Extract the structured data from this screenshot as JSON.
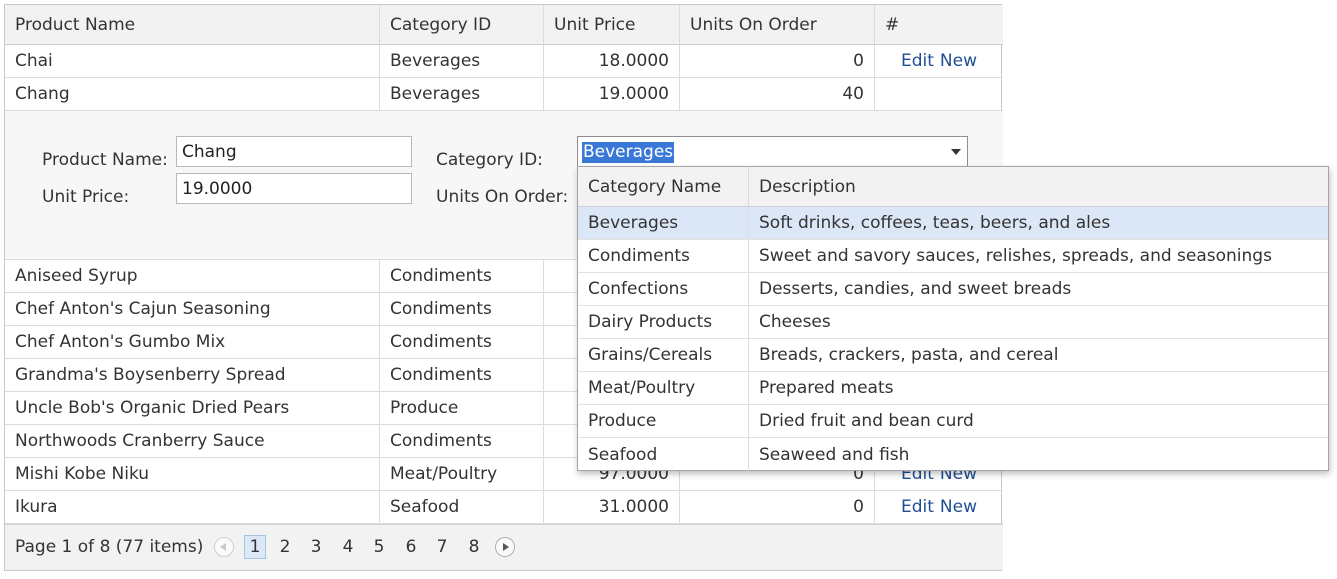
{
  "grid": {
    "headers": [
      "Product Name",
      "Category ID",
      "Unit Price",
      "Units On Order",
      "#"
    ],
    "rows_top": [
      {
        "name": "Chai",
        "category": "Beverages",
        "price": "18.0000",
        "on_order": "0",
        "edit": "Edit",
        "new": "New"
      },
      {
        "name": "Chang",
        "category": "Beverages",
        "price": "19.0000",
        "on_order": "40",
        "edit": "",
        "new": ""
      }
    ],
    "rows_bottom": [
      {
        "name": "Aniseed Syrup",
        "category": "Condiments",
        "price": "",
        "on_order": "",
        "edit": "",
        "new": ""
      },
      {
        "name": "Chef Anton's Cajun Seasoning",
        "category": "Condiments",
        "price": "",
        "on_order": "",
        "edit": "",
        "new": ""
      },
      {
        "name": "Chef Anton's Gumbo Mix",
        "category": "Condiments",
        "price": "",
        "on_order": "",
        "edit": "",
        "new": ""
      },
      {
        "name": "Grandma's Boysenberry Spread",
        "category": "Condiments",
        "price": "",
        "on_order": "",
        "edit": "",
        "new": ""
      },
      {
        "name": "Uncle Bob's Organic Dried Pears",
        "category": "Produce",
        "price": "",
        "on_order": "",
        "edit": "",
        "new": ""
      },
      {
        "name": "Northwoods Cranberry Sauce",
        "category": "Condiments",
        "price": "",
        "on_order": "",
        "edit": "",
        "new": ""
      },
      {
        "name": "Mishi Kobe Niku",
        "category": "Meat/Poultry",
        "price": "97.0000",
        "on_order": "0",
        "edit": "Edit",
        "new": "New"
      },
      {
        "name": "Ikura",
        "category": "Seafood",
        "price": "31.0000",
        "on_order": "0",
        "edit": "Edit",
        "new": "New"
      }
    ]
  },
  "editform": {
    "product_name_label": "Product Name:",
    "product_name_value": "Chang",
    "unit_price_label": "Unit Price:",
    "unit_price_value": "19.0000",
    "category_label": "Category ID:",
    "category_value": "Beverages",
    "units_on_order_label": "Units On Order:"
  },
  "dropdown": {
    "headers": [
      "Category Name",
      "Description"
    ],
    "selected_index": 0,
    "items": [
      {
        "name": "Beverages",
        "description": "Soft drinks, coffees, teas, beers, and ales"
      },
      {
        "name": "Condiments",
        "description": "Sweet and savory sauces, relishes, spreads, and seasonings"
      },
      {
        "name": "Confections",
        "description": "Desserts, candies, and sweet breads"
      },
      {
        "name": "Dairy Products",
        "description": "Cheeses"
      },
      {
        "name": "Grains/Cereals",
        "description": "Breads, crackers, pasta, and cereal"
      },
      {
        "name": "Meat/Poultry",
        "description": "Prepared meats"
      },
      {
        "name": "Produce",
        "description": "Dried fruit and bean curd"
      },
      {
        "name": "Seafood",
        "description": "Seaweed and fish"
      }
    ]
  },
  "pager": {
    "info": "Page 1 of 8 (77 items)",
    "pages": [
      "1",
      "2",
      "3",
      "4",
      "5",
      "6",
      "7",
      "8"
    ],
    "current_page": "1",
    "prev_icon": "chevron-left-icon",
    "next_icon": "chevron-right-icon"
  },
  "colors": {
    "header_bg": "#f2f2f2",
    "link": "#1f4e96",
    "selection": "#3a78d8",
    "dropdown_selected_row": "#dbe6f7"
  }
}
